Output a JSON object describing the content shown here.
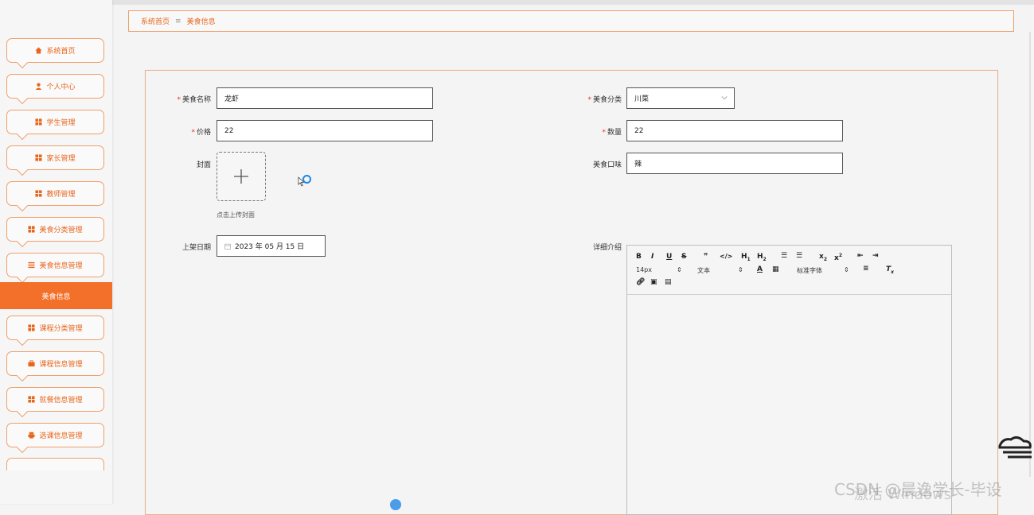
{
  "colors": {
    "accent": "#f3702b",
    "border": "#f0a06a",
    "required": "#e53333"
  },
  "sidebar": {
    "items": [
      {
        "label": "系统首页",
        "icon": "home-icon"
      },
      {
        "label": "个人中心",
        "icon": "user-icon"
      },
      {
        "label": "学生管理",
        "icon": "grid-icon"
      },
      {
        "label": "家长管理",
        "icon": "grid-icon"
      },
      {
        "label": "教师管理",
        "icon": "grid-icon"
      },
      {
        "label": "美食分类管理",
        "icon": "grid-icon"
      },
      {
        "label": "美食信息管理",
        "icon": "list-icon"
      },
      {
        "label": "课程分类管理",
        "icon": "grid-icon"
      },
      {
        "label": "课程信息管理",
        "icon": "briefcase-icon"
      },
      {
        "label": "就餐信息管理",
        "icon": "grid-icon"
      },
      {
        "label": "选课信息管理",
        "icon": "print-icon"
      }
    ],
    "active_sub": "美食信息"
  },
  "breadcrumb": {
    "home": "系统首页",
    "separator": "≡",
    "current": "美食信息"
  },
  "form": {
    "name_label": "美食名称",
    "name_value": "龙虾",
    "category_label": "美食分类",
    "category_value": "川菜",
    "price_label": "价格",
    "price_value": "22",
    "quantity_label": "数量",
    "quantity_value": "22",
    "cover_label": "封面",
    "cover_hint": "点击上传封面",
    "taste_label": "美食口味",
    "taste_value": "辣",
    "date_label": "上架日期",
    "date_value": "2023 年 05 月 15 日",
    "detail_label": "详细介绍"
  },
  "editor": {
    "font_size": "14px",
    "paragraph": "文本",
    "font_family": "标准字体"
  },
  "watermark": {
    "line1": "CSDN @晨逸学长-毕设",
    "line2": "激活 Windows"
  }
}
